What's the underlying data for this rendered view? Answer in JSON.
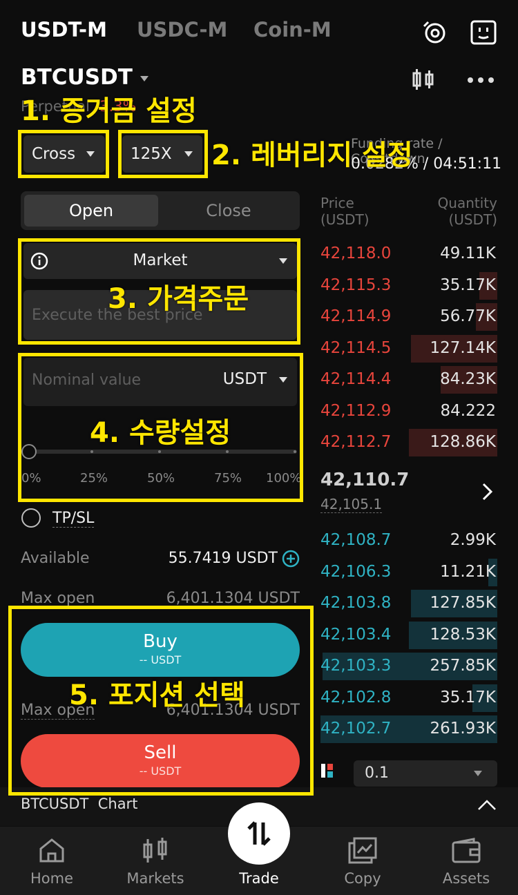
{
  "tabs": [
    "USDT-M",
    "USDC-M",
    "Coin-M"
  ],
  "symbol": "BTCUSDT",
  "perpetual_label": "Perpetual",
  "change": "-3.3%",
  "margin_mode": "Cross",
  "leverage": "125X",
  "funding_label": "Funding rate / Countdown",
  "funding_value": "0.0282% / 04:51:11",
  "order_tabs": {
    "open": "Open",
    "close": "Close"
  },
  "order_type": "Market",
  "price_placeholder": "Execute the best price",
  "nominal_placeholder": "Nominal value",
  "nominal_unit": "USDT",
  "slider_marks": [
    "0%",
    "25%",
    "50%",
    "75%",
    "100%"
  ],
  "slider_value_pct": 0,
  "tpsl_label": "TP/SL",
  "available_label": "Available",
  "available_value": "55.7419 USDT",
  "max_open_label": "Max open",
  "max_open_value": "6,401.1304 USDT",
  "buy_label": "Buy",
  "buy_sub": "-- USDT",
  "sell_label": "Sell",
  "sell_sub": "-- USDT",
  "orderbook": {
    "price_header": "Price\n(USDT)",
    "qty_header": "Quantity\n(USDT)",
    "asks": [
      {
        "price": "42,118.0",
        "qty": "49.11K",
        "depth": 0.0
      },
      {
        "price": "42,115.3",
        "qty": "35.17K",
        "depth": 0.1
      },
      {
        "price": "42,114.9",
        "qty": "56.77K",
        "depth": 0.12
      },
      {
        "price": "42,114.5",
        "qty": "127.14K",
        "depth": 0.49
      },
      {
        "price": "42,114.4",
        "qty": "84.23K",
        "depth": 0.32
      },
      {
        "price": "42,112.9",
        "qty": "84.222",
        "depth": 0.0
      },
      {
        "price": "42,112.7",
        "qty": "128.86K",
        "depth": 0.5
      }
    ],
    "last_price": "42,110.7",
    "mark_price": "42,105.1",
    "bids": [
      {
        "price": "42,108.7",
        "qty": "2.99K",
        "depth": 0.0
      },
      {
        "price": "42,106.3",
        "qty": "11.21K",
        "depth": 0.05
      },
      {
        "price": "42,103.8",
        "qty": "127.85K",
        "depth": 0.49
      },
      {
        "price": "42,103.4",
        "qty": "128.53K",
        "depth": 0.5
      },
      {
        "price": "42,103.3",
        "qty": "257.85K",
        "depth": 0.99
      },
      {
        "price": "42,102.8",
        "qty": "35.17K",
        "depth": 0.14
      },
      {
        "price": "42,102.7",
        "qty": "261.93K",
        "depth": 1.0
      }
    ],
    "precision": "0.1"
  },
  "chart_label": "BTCUSDT  Chart",
  "nav": [
    "Home",
    "Markets",
    "Trade",
    "Copy",
    "Assets"
  ],
  "annotations": {
    "a1": "1. 증거금 설정",
    "a2": "2. 레버리지 설정",
    "a3": "3. 가격주문",
    "a4": "4. 수량설정",
    "a5": "5. 포지션 선택"
  },
  "colors": {
    "ask": "#e8453c",
    "bid": "#2fb3c4",
    "buy": "#1ea3b3",
    "sell": "#ee4a3f",
    "annotation": "#ffe600"
  }
}
